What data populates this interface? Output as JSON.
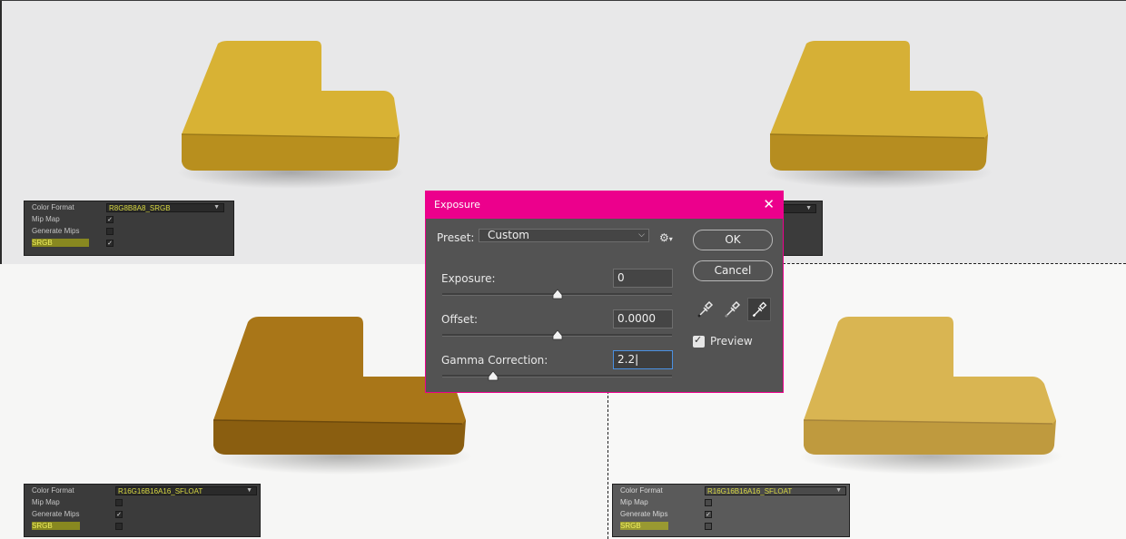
{
  "dialog": {
    "title": "Exposure",
    "close_glyph": "✕",
    "preset_label": "Preset:",
    "preset_value": "Custom",
    "exposure_label": "Exposure:",
    "exposure_value": "0",
    "exposure_slider": 0.5,
    "offset_label": "Offset:",
    "offset_value": "0.0000",
    "offset_slider": 0.5,
    "gamma_label": "Gamma Correction:",
    "gamma_value": "2.2",
    "gamma_slider": 0.22,
    "ok_label": "OK",
    "cancel_label": "Cancel",
    "preview_label": "Preview",
    "preview_checked": true,
    "title_color": "#ec008c",
    "eyedroppers": [
      "eyedropper-black-icon",
      "eyedropper-gray-icon",
      "eyedropper-white-icon"
    ]
  },
  "panels": {
    "top_left": {
      "rows": [
        {
          "label": "Color Format",
          "value": "R8G8B8A8_SRGB"
        },
        {
          "label": "Mip Map",
          "checked": true
        },
        {
          "label": "Generate Mips",
          "checked": false
        },
        {
          "label": "SRGB",
          "checked": true
        }
      ]
    },
    "bottom_left": {
      "rows": [
        {
          "label": "Color Format",
          "value": "R16G16B16A16_SFLOAT"
        },
        {
          "label": "Mip Map",
          "checked": false
        },
        {
          "label": "Generate Mips",
          "checked": true
        },
        {
          "label": "SRGB",
          "checked": false
        }
      ]
    },
    "bottom_right": {
      "rows": [
        {
          "label": "Color Format",
          "value": "R16G16B16A16_SFLOAT"
        },
        {
          "label": "Mip Map",
          "checked": false
        },
        {
          "label": "Generate Mips",
          "checked": true
        },
        {
          "label": "SRGB",
          "checked": false
        }
      ]
    }
  },
  "colors": {
    "highlight": "#e6e600",
    "sofa_srgb": "#d4ae2a",
    "sofa_dark": "#a97618",
    "sofa_light": "#d9b552"
  }
}
